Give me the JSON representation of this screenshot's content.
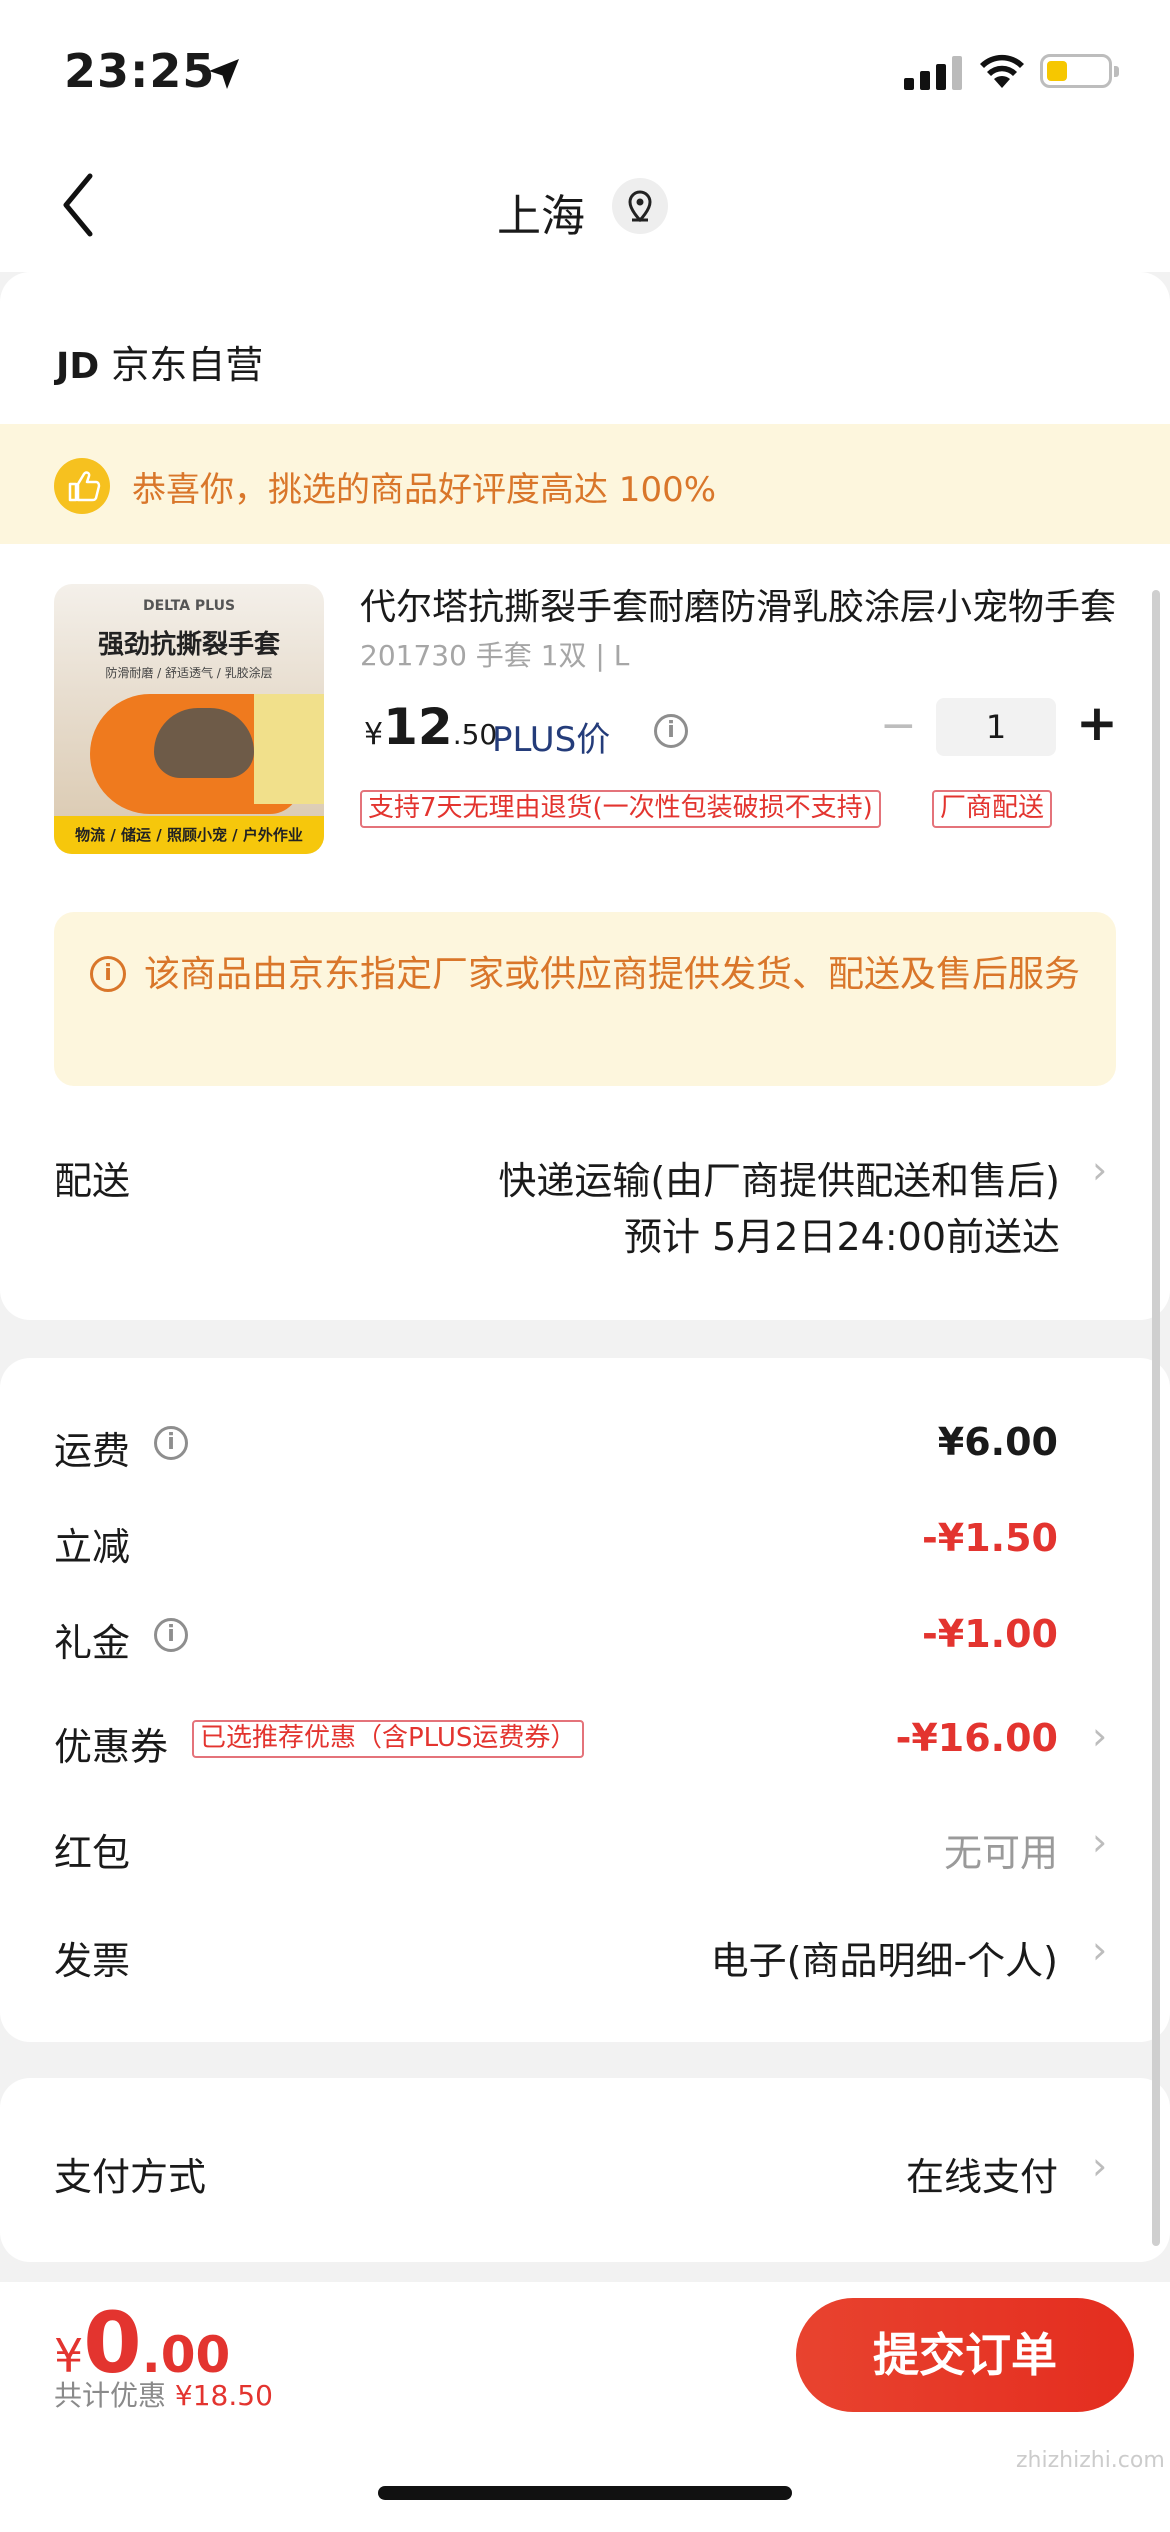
{
  "status_bar": {
    "time": "23:25"
  },
  "nav": {
    "title": "上海"
  },
  "shop": {
    "logo": "JD",
    "name": "京东自营"
  },
  "banner": {
    "text": "恭喜你，挑选的商品好评度高达 100%"
  },
  "product": {
    "image": {
      "brand": "DELTA PLUS",
      "headline": "强劲抗撕裂手套",
      "features": "防滑耐磨 / 舒适透气 / 乳胶涂层",
      "footer": "物流 / 储运 / 照顾小宠 / 户外作业"
    },
    "title": "代尔塔抗撕裂手套耐磨防滑乳胶涂层小宠物手套",
    "spec": "201730 手套 1双 | L",
    "price_currency": "¥",
    "price_int": "12",
    "price_dec": ".50",
    "price_label": "PLUS价",
    "quantity": "1",
    "tags": [
      "支持7天无理由退货(一次性包装破损不支持)",
      "厂商配送"
    ]
  },
  "notice": {
    "text": "该商品由京东指定厂家或供应商提供发货、配送及售后服务"
  },
  "delivery": {
    "label": "配送",
    "method": "快递运输(由厂商提供配送和售后)",
    "eta": "预计 5月2日24:00前送达"
  },
  "fees": {
    "shipping": {
      "label": "运费",
      "value": "¥6.00"
    },
    "discount": {
      "label": "立减",
      "value": "-¥1.50"
    },
    "gift": {
      "label": "礼金",
      "value": "-¥1.00"
    },
    "coupon": {
      "label": "优惠券",
      "tag": "已选推荐优惠（含PLUS运费券）",
      "value": "-¥16.00"
    },
    "red_packet": {
      "label": "红包",
      "value": "无可用"
    },
    "invoice": {
      "label": "发票",
      "value": "电子(商品明细-个人)"
    }
  },
  "payment": {
    "label": "支付方式",
    "value": "在线支付"
  },
  "footer": {
    "currency": "¥",
    "total_int": "0",
    "total_dec": ".00",
    "saving_label": "共计优惠",
    "saving_value": "¥18.50",
    "submit_label": "提交订单"
  },
  "watermark": "zhizhizhi.com",
  "colors": {
    "accent_red": "#e3342f",
    "notice_orange": "#d9762a",
    "plus_blue": "#243c7a"
  }
}
